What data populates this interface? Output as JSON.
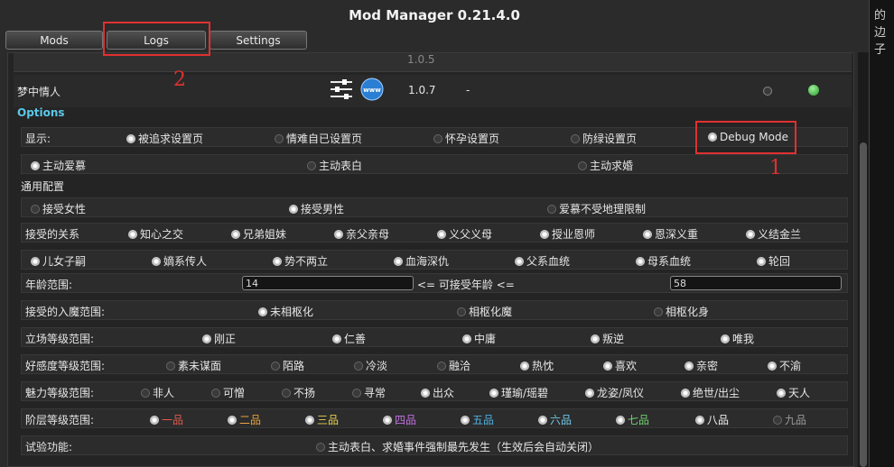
{
  "window": {
    "title": "Mod Manager 0.21.4.0"
  },
  "side_text": [
    "的",
    "边",
    "子"
  ],
  "tabs": [
    "Mods",
    "Logs",
    "Settings"
  ],
  "annotations": {
    "one": "1",
    "two": "2"
  },
  "mod": {
    "name": "梦中情人",
    "version": "1.0.7",
    "dash": "-",
    "prev_version": "1.0.5"
  },
  "options_label": "Options",
  "rows": {
    "display": {
      "label": "显示:",
      "items": [
        "被追求设置页",
        "情难自已设置页",
        "怀孕设置页",
        "防绿设置页",
        "Debug Mode"
      ]
    },
    "active": {
      "items": [
        "主动爱慕",
        "主动表白",
        "主动求婚"
      ]
    },
    "general_label": "通用配置",
    "gender": {
      "items": [
        "接受女性",
        "接受男性",
        "爱慕不受地理限制"
      ]
    },
    "relation1": {
      "label": "接受的关系",
      "items": [
        "知心之交",
        "兄弟姐妹",
        "亲父亲母",
        "义父义母",
        "授业恩师",
        "恩深义重",
        "义结金兰"
      ]
    },
    "relation2": {
      "items": [
        "儿女子嗣",
        "嫡系传人",
        "势不两立",
        "血海深仇",
        "父系血统",
        "母系血统",
        "轮回"
      ]
    },
    "age": {
      "label": "年龄范围:",
      "min": "14",
      "mid": "<= 可接受年龄 <=",
      "max": "58"
    },
    "demon": {
      "label": "接受的入魔范围:",
      "items": [
        "未相枢化",
        "相枢化魔",
        "相枢化身"
      ]
    },
    "stance": {
      "label": "立场等级范围:",
      "items": [
        "刚正",
        "仁善",
        "中庸",
        "叛逆",
        "唯我"
      ]
    },
    "favor": {
      "label": "好感度等级范围:",
      "items": [
        "素未谋面",
        "陌路",
        "冷淡",
        "融洽",
        "热忱",
        "喜欢",
        "亲密",
        "不渝"
      ]
    },
    "charm": {
      "label": "魅力等级范围:",
      "items": [
        "非人",
        "可憎",
        "不扬",
        "寻常",
        "出众",
        "瑾瑜/瑶碧",
        "龙姿/凤仪",
        "绝世/出尘",
        "天人"
      ]
    },
    "rank": {
      "label": "阶层等级范围:",
      "items": [
        "一品",
        "二品",
        "三品",
        "四品",
        "五品",
        "六品",
        "七品",
        "八品",
        "九品"
      ],
      "colors": [
        "#e35a4d",
        "#e8a040",
        "#e8d050",
        "#c070e0",
        "#4fb0e0",
        "#70c8e8",
        "#70d070",
        "#f0f0f0",
        "#9a9a9a"
      ]
    },
    "trial": {
      "label": "试验功能:",
      "item": "主动表白、求婚事件强制最先发生（生效后会自动关闭）"
    }
  }
}
